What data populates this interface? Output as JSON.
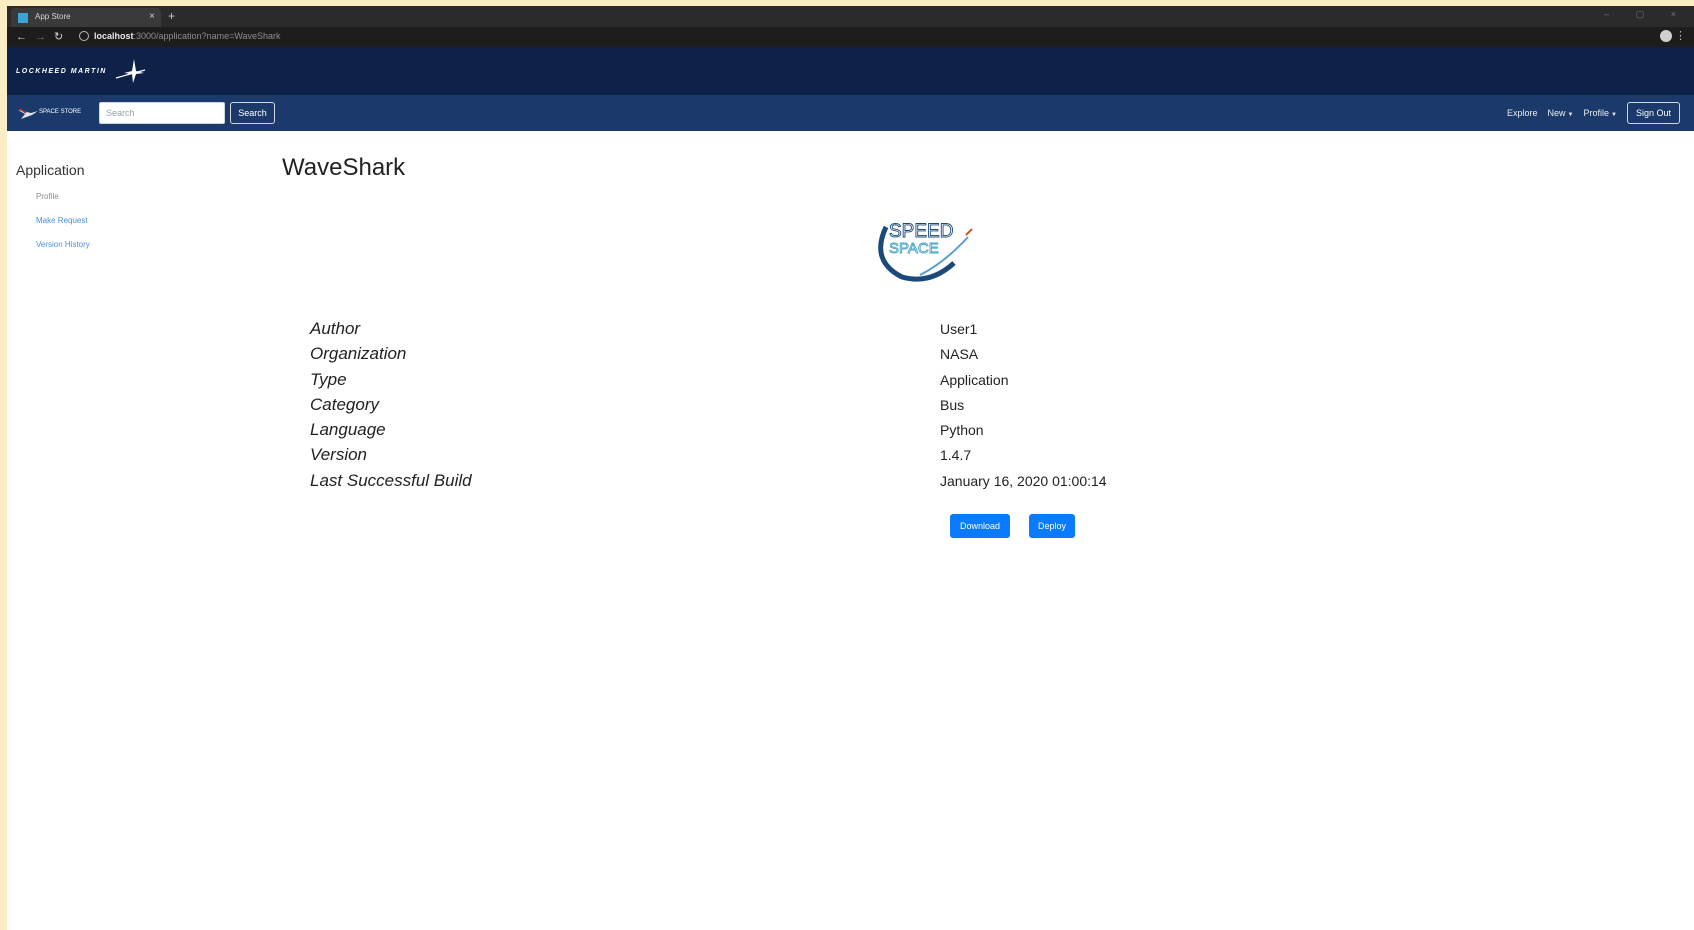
{
  "browser": {
    "tab_title": "App Store",
    "tab_close": "×",
    "new_tab": "+",
    "window_controls": "– ▢ ×",
    "back": "←",
    "forward": "→",
    "reload": "↻",
    "url_host": "localhost",
    "url_path": ":3000/application?name=WaveShark",
    "menu": "⋮"
  },
  "header": {
    "logo_text": "LOCKHEED MARTIN",
    "brand_text": "SPACE STORE"
  },
  "navbar": {
    "search_placeholder": "Search",
    "search_button": "Search",
    "explore": "Explore",
    "new": "New",
    "profile": "Profile",
    "caret": "▼",
    "sign_out": "Sign Out"
  },
  "sidebar": {
    "heading": "Application",
    "items": [
      {
        "label": "Profile"
      },
      {
        "label": "Make Request"
      },
      {
        "label": "Version History"
      }
    ]
  },
  "main": {
    "title": "WaveShark",
    "logo_line1": "SPEED",
    "logo_line2": "SPACE",
    "details": [
      {
        "label": "Author",
        "value": "User1"
      },
      {
        "label": "Organization",
        "value": "NASA"
      },
      {
        "label": "Type",
        "value": "Application"
      },
      {
        "label": "Category",
        "value": "Bus"
      },
      {
        "label": "Language",
        "value": "Python"
      },
      {
        "label": "Version",
        "value": "1.4.7"
      },
      {
        "label": "Last Successful Build",
        "value": "January 16, 2020 01:00:14"
      }
    ],
    "download_button": "Download",
    "deploy_button": "Deploy"
  },
  "colors": {
    "accent": "#0a7bff",
    "header_dark": "#0e2149",
    "navbar": "#1b3a6b",
    "link": "#4a90e2"
  }
}
